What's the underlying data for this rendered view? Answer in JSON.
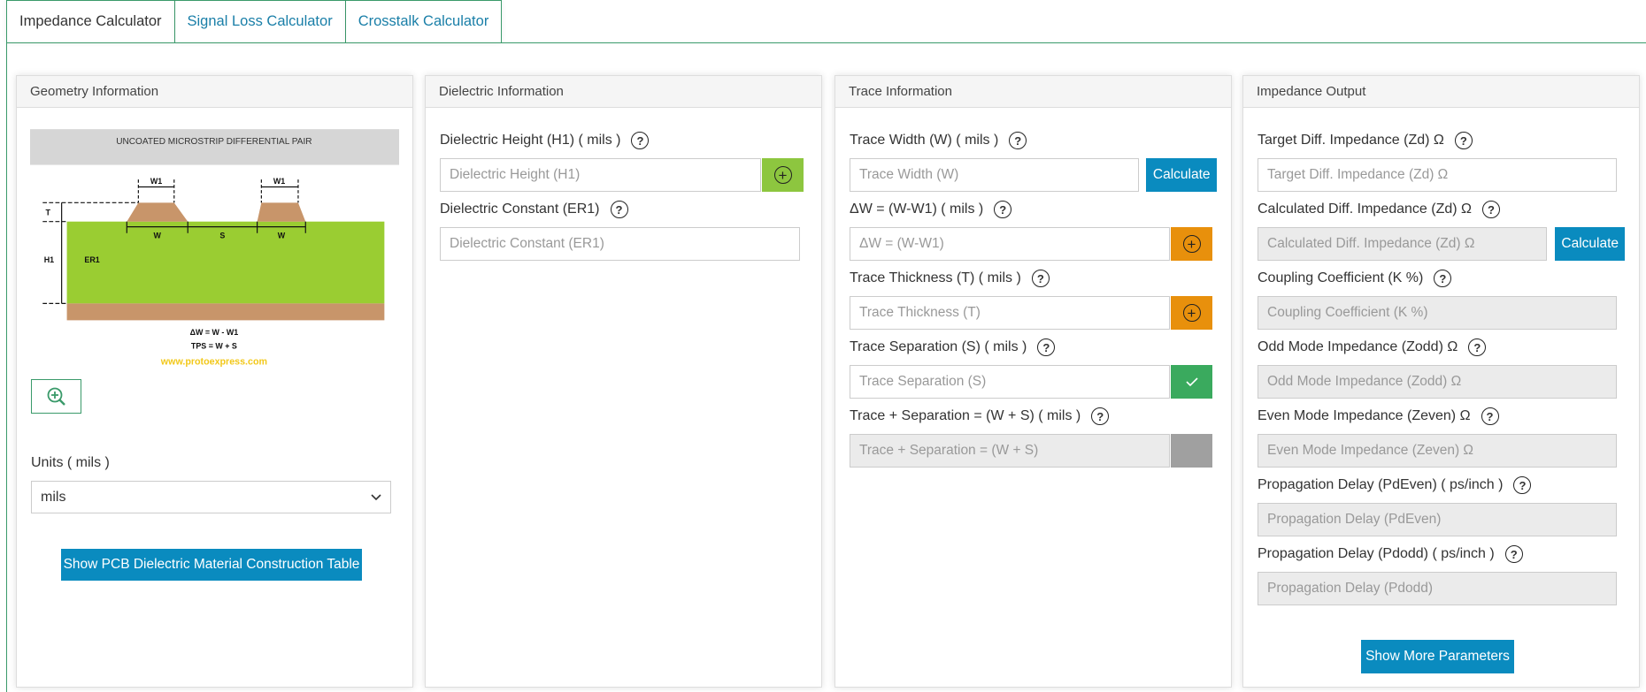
{
  "tabs": [
    {
      "label": "Impedance Calculator",
      "active": true
    },
    {
      "label": "Signal Loss Calculator",
      "active": false
    },
    {
      "label": "Crosstalk Calculator",
      "active": false
    }
  ],
  "geometry": {
    "title": "Geometry Information",
    "diagram": {
      "banner": "UNCOATED MICROSTRIP DIFFERENTIAL PAIR",
      "labels": {
        "w1": "W1",
        "t": "T",
        "h1": "H1",
        "er1": "ER1",
        "w": "W",
        "s": "S"
      },
      "formula1": "ΔW = W - W1",
      "formula2": "TPS = W + S",
      "website": "www.protoexpress.com"
    },
    "units_label": "Units ( mils )",
    "units_value": "mils",
    "table_button": "Show PCB Dielectric Material Construction Table"
  },
  "dielectric": {
    "title": "Dielectric Information",
    "fields": [
      {
        "label": "Dielectric Height (H1) ( mils )",
        "placeholder": "Dielectric Height (H1)"
      },
      {
        "label": "Dielectric Constant (ER1)",
        "placeholder": "Dielectric Constant (ER1)"
      }
    ]
  },
  "trace": {
    "title": "Trace Information",
    "calculate": "Calculate",
    "fields": [
      {
        "label": "Trace Width (W) ( mils )",
        "placeholder": "Trace Width (W)"
      },
      {
        "label": "ΔW = (W-W1) ( mils )",
        "placeholder": "ΔW = (W-W1)"
      },
      {
        "label": "Trace Thickness (T) ( mils )",
        "placeholder": "Trace Thickness (T)"
      },
      {
        "label": "Trace Separation (S) ( mils )",
        "placeholder": "Trace Separation (S)"
      },
      {
        "label": "Trace + Separation = (W + S) ( mils )",
        "placeholder": "Trace + Separation = (W + S)"
      }
    ]
  },
  "output": {
    "title": "Impedance Output",
    "calculate": "Calculate",
    "more_button": "Show More Parameters",
    "fields": [
      {
        "label": "Target Diff. Impedance (Zd) Ω",
        "placeholder": "Target Diff. Impedance (Zd) Ω"
      },
      {
        "label": "Calculated Diff. Impedance (Zd) Ω",
        "placeholder": "Calculated Diff. Impedance (Zd) Ω"
      },
      {
        "label": "Coupling Coefficient (K %)",
        "placeholder": "Coupling Coefficient (K %)"
      },
      {
        "label": "Odd Mode Impedance (Zodd) Ω",
        "placeholder": "Odd Mode Impedance (Zodd) Ω"
      },
      {
        "label": "Even Mode Impedance (Zeven) Ω",
        "placeholder": "Even Mode Impedance (Zeven) Ω"
      },
      {
        "label": "Propagation Delay (PdEven) ( ps/inch )",
        "placeholder": "Propagation Delay (PdEven)"
      },
      {
        "label": "Propagation Delay (Pdodd) ( ps/inch )",
        "placeholder": "Propagation Delay (Pdodd)"
      }
    ]
  },
  "help_symbol": "?",
  "colors": {
    "accent_green": "#3a9a6a",
    "button_blue": "#0a8bbf",
    "addon_lime": "#8dc63f",
    "addon_orange": "#e8900c",
    "addon_check": "#3aaa5e",
    "addon_gray": "#a0a0a0",
    "dielectric": "#9acd32",
    "copper": "#c8956a"
  }
}
